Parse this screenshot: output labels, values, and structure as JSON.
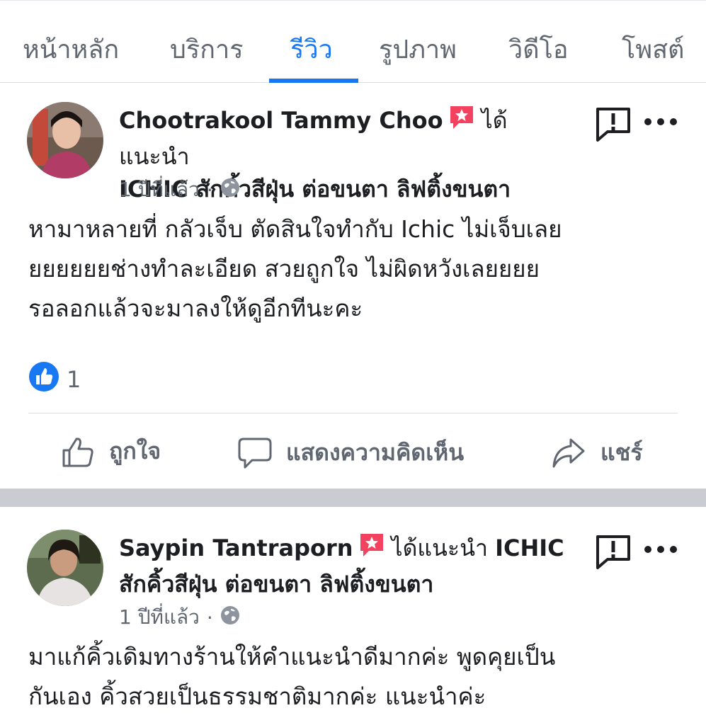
{
  "tabs": [
    {
      "label": "หน้าหลัก",
      "active": false
    },
    {
      "label": "บริการ",
      "active": false
    },
    {
      "label": "รีวิว",
      "active": true
    },
    {
      "label": "รูปภาพ",
      "active": false
    },
    {
      "label": "วิดีโอ",
      "active": false
    },
    {
      "label": "โพสต์",
      "active": false
    }
  ],
  "colors": {
    "accent": "#1877f2",
    "recommend_badge": "#f3425f",
    "muted": "#606770"
  },
  "posts": [
    {
      "author": "Chootrakool Tammy Choo",
      "recommend_text": "ได้แนะนำ",
      "page_name": "ICHIC สักคิ้วสีฝุ่น ต่อขนตา ลิฟติ้งขนตา",
      "time": "1 ปีที่แล้ว",
      "separator": "·",
      "privacy_icon": "globe-icon",
      "body": "หามาหลายที่ กลัวเจ็บ ตัดสินใจทำกับ Ichic ไม่เจ็บเลยยยยยยยช่างทำละเอียด สวยถูกใจ ไม่ผิดหวังเลยยยยรอลอกแล้วจะมาลงให้ดูอีกทีนะคะ",
      "body_lines": [
        "หามาหลายที่ กลัวเจ็บ ตัดสินใจทำกับ Ichic ไม่เจ็บเลย",
        "ยยยยยยช่างทำละเอียด สวยถูกใจ ไม่ผิดหวังเลยยยย",
        "รอลอกแล้วจะมาลงให้ดูอีกทีนะคะ"
      ],
      "like_count": "1",
      "actions": {
        "like": "ถูกใจ",
        "comment": "แสดงความคิดเห็น",
        "share": "แชร์"
      }
    },
    {
      "author": "Saypin Tantraporn",
      "recommend_text": "ได้แนะนำ",
      "page_name_line1": "ICHIC",
      "page_name_line2": "สักคิ้วสีฝุ่น ต่อขนตา ลิฟติ้งขนตา",
      "time": "1 ปีที่แล้ว",
      "separator": "·",
      "privacy_icon": "globe-icon",
      "body_lines": [
        "มาแก้คิ้วเดิมทางร้านให้คำแนะนำดีมากค่ะ พูดคุยเป็น",
        "กันเอง คิ้วสวยเป็นธรรมชาติมากค่ะ แนะนำค่ะ"
      ]
    }
  ]
}
